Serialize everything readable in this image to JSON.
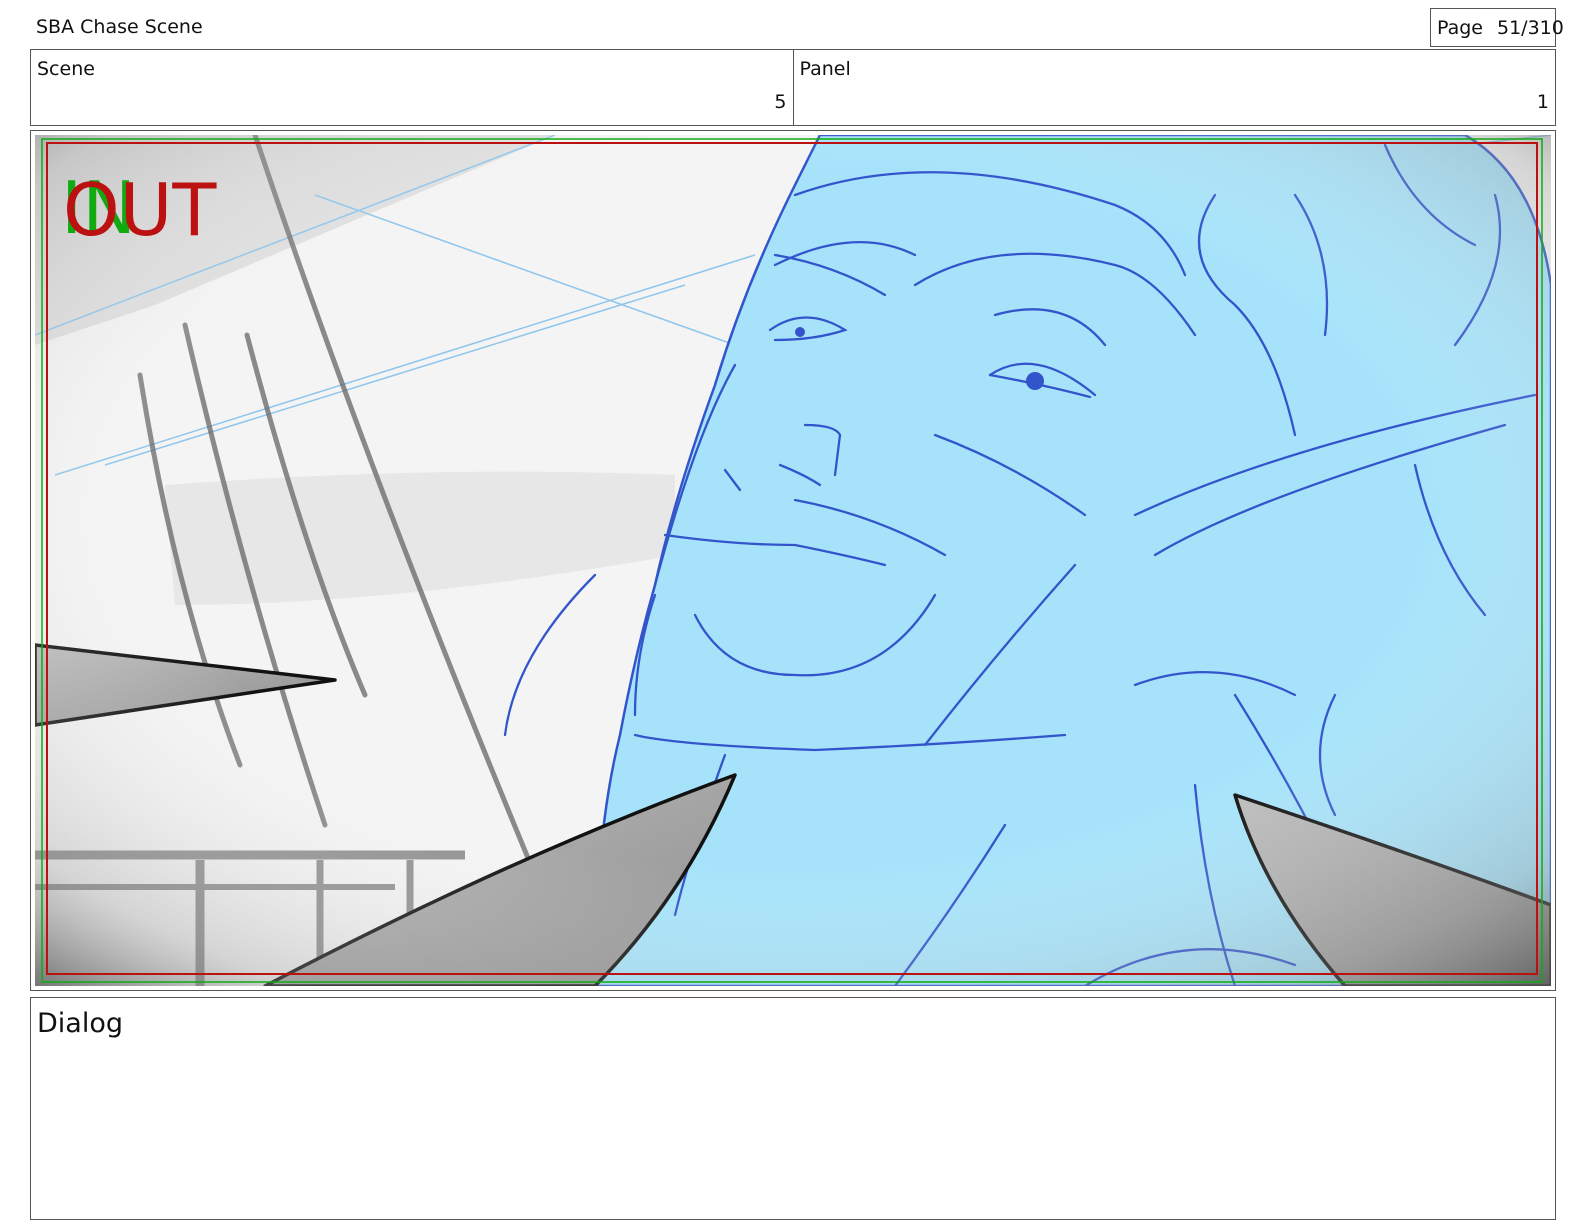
{
  "document": {
    "title": "SBA Chase Scene"
  },
  "page": {
    "label": "Page",
    "value": "51/310"
  },
  "scene": {
    "label": "Scene",
    "value": "5"
  },
  "panel": {
    "label": "Panel",
    "value": "1"
  },
  "overlay": {
    "in_text": "IN",
    "out_text": "OUT"
  },
  "colors": {
    "sketch_fill": "#a6e3fa",
    "sketch_line": "#3355cc",
    "frame_red": "#bb1111",
    "frame_green": "#11aa11"
  },
  "dialog": {
    "label": "Dialog"
  }
}
